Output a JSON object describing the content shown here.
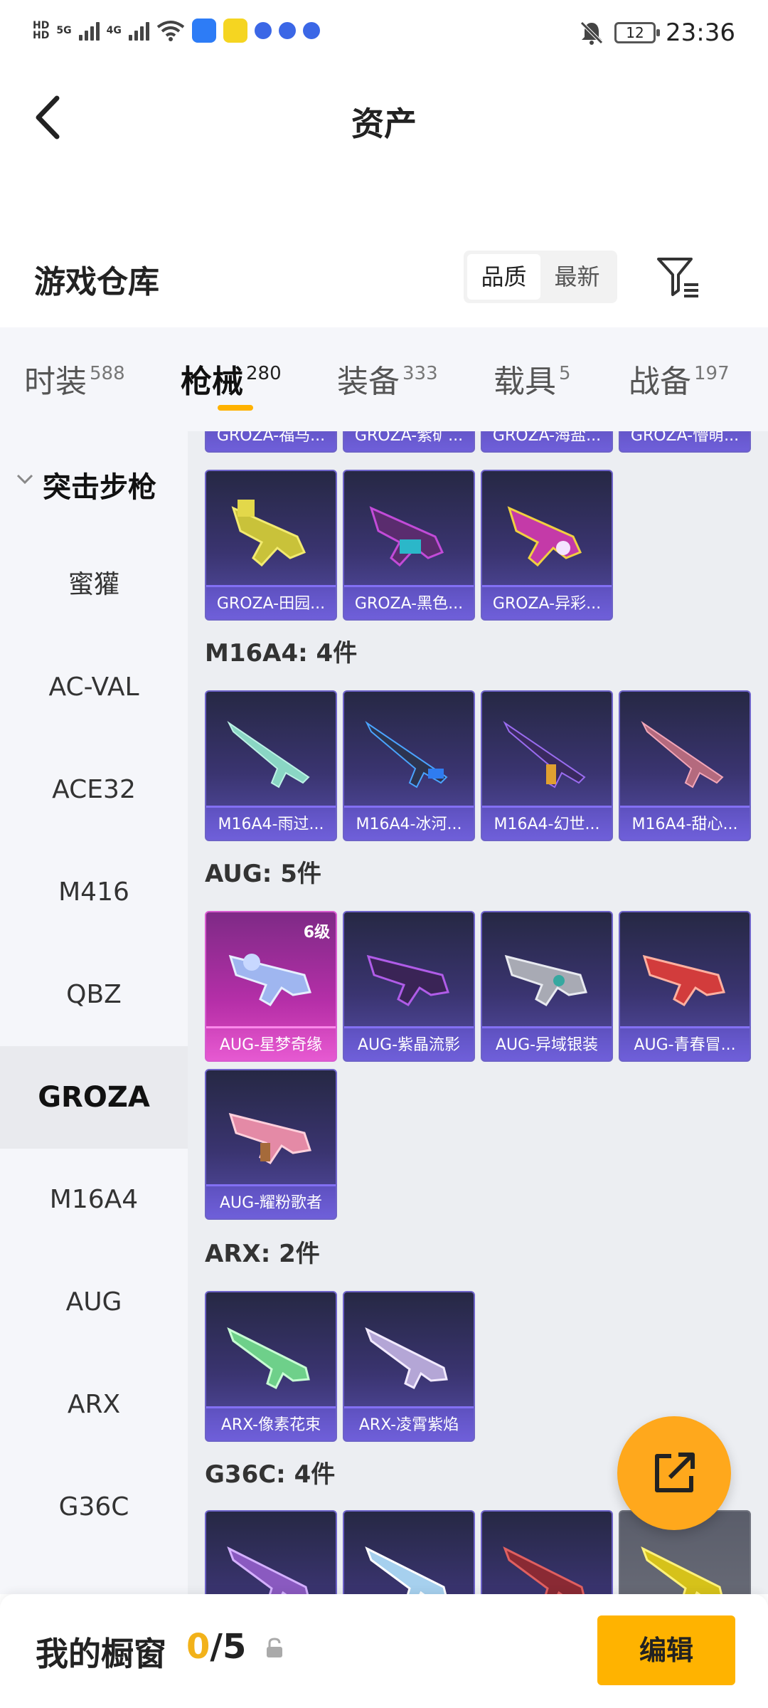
{
  "status_bar": {
    "net1": "HD",
    "net2": "HD",
    "sig1": "5G",
    "sig2": "4G",
    "time": "23:36",
    "battery": "12"
  },
  "header": {
    "title": "资产"
  },
  "warehouse": {
    "title": "游戏仓库",
    "sort_options": [
      "品质",
      "最新"
    ],
    "sort_selected": "品质"
  },
  "tabs": [
    {
      "label": "时装",
      "count": "588"
    },
    {
      "label": "枪械",
      "count": "280",
      "active": true
    },
    {
      "label": "装备",
      "count": "333"
    },
    {
      "label": "载具",
      "count": "5"
    },
    {
      "label": "战备",
      "count": "197"
    }
  ],
  "sidebar": {
    "group": "突击步枪",
    "items": [
      "蜜獾",
      "AC-VAL",
      "ACE32",
      "M416",
      "QBZ",
      "GROZA",
      "M16A4",
      "AUG",
      "ARX",
      "G36C"
    ],
    "active": "GROZA"
  },
  "sections": {
    "groza_top": [
      "GROZA-福马...",
      "GROZA-紫矿...",
      "GROZA-海盐...",
      "GROZA-懵萌..."
    ],
    "groza_row": [
      "GROZA-田园...",
      "GROZA-黑色...",
      "GROZA-异彩..."
    ],
    "m16a4_title": "M16A4: 4件",
    "m16a4": [
      "M16A4-雨过...",
      "M16A4-冰河...",
      "M16A4-幻世...",
      "M16A4-甜心..."
    ],
    "aug_title": "AUG: 5件",
    "aug": [
      "AUG-星梦奇缘",
      "AUG-紫晶流影",
      "AUG-异域银装",
      "AUG-青春冒...",
      "AUG-耀粉歌者"
    ],
    "aug_badge": "6级",
    "arx_title": "ARX: 2件",
    "arx": [
      "ARX-像素花束",
      "ARX-凌霄紫焰"
    ],
    "g36c_title": "G36C: 4件"
  },
  "bottom": {
    "title": "我的橱窗",
    "current": "0",
    "separator": "/",
    "total": "5",
    "edit_label": "编辑"
  },
  "colors": {
    "accent": "#ffb300",
    "fab": "#ffa81c",
    "card_purple": "#564ea8",
    "card_pink": "#e04bc2"
  }
}
